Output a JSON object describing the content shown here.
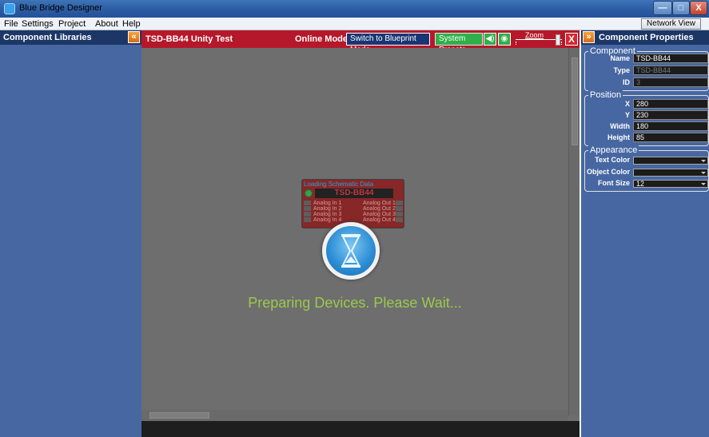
{
  "window": {
    "title": "Blue Bridge Designer",
    "min_symbol": "—",
    "max_symbol": "□",
    "close_symbol": "X"
  },
  "menu": {
    "items": [
      "File",
      "Settings",
      "Project",
      "About",
      "Help"
    ],
    "network_view": "Network View"
  },
  "left_panel": {
    "title": "Component Libraries",
    "collapse_symbol": "«"
  },
  "toolbar": {
    "device_title": "TSD-BB44 Unity Test",
    "mode": "Online Mode",
    "switch_button": "Switch to Blueprint Mode",
    "presets_button": "System Presets",
    "zoom_label": "Zoom",
    "close_symbol": "X"
  },
  "device": {
    "loading_text": "Loading Schematic Data",
    "name": "TSD-BB44",
    "inputs": [
      "Analog In 1",
      "Analog In 2",
      "Analog In 3",
      "Analog In 4"
    ],
    "outputs": [
      "Analog Out 1",
      "Analog Out 2",
      "Analog Out 3",
      "Analog Out 4"
    ]
  },
  "status": {
    "wait_message": "Preparing Devices. Please Wait..."
  },
  "right_panel": {
    "title": "Component Properties",
    "expand_symbol": "»",
    "component": {
      "title": "Component",
      "name_label": "Name",
      "name_value": "TSD-BB44",
      "type_label": "Type",
      "type_value": "TSD-BB44",
      "id_label": "ID",
      "id_value": "3"
    },
    "position": {
      "title": "Position",
      "x_label": "X",
      "x_value": "280",
      "y_label": "Y",
      "y_value": "230",
      "width_label": "Width",
      "width_value": "180",
      "height_label": "Height",
      "height_value": "85"
    },
    "appearance": {
      "title": "Appearance",
      "text_color_label": "Text Color",
      "text_color_value": "",
      "object_color_label": "Object Color",
      "object_color_value": "",
      "font_size_label": "Font Size",
      "font_size_value": "12"
    }
  },
  "colors": {
    "toolbar_red": "#b5182a",
    "panel_blue": "#4767a2",
    "header_navy": "#1c3666",
    "wait_green": "#9bc94b"
  },
  "icons": [
    "app-icon",
    "speaker-icon",
    "eye-icon",
    "hourglass-icon",
    "chevron-left-icon",
    "chevron-right-icon"
  ]
}
